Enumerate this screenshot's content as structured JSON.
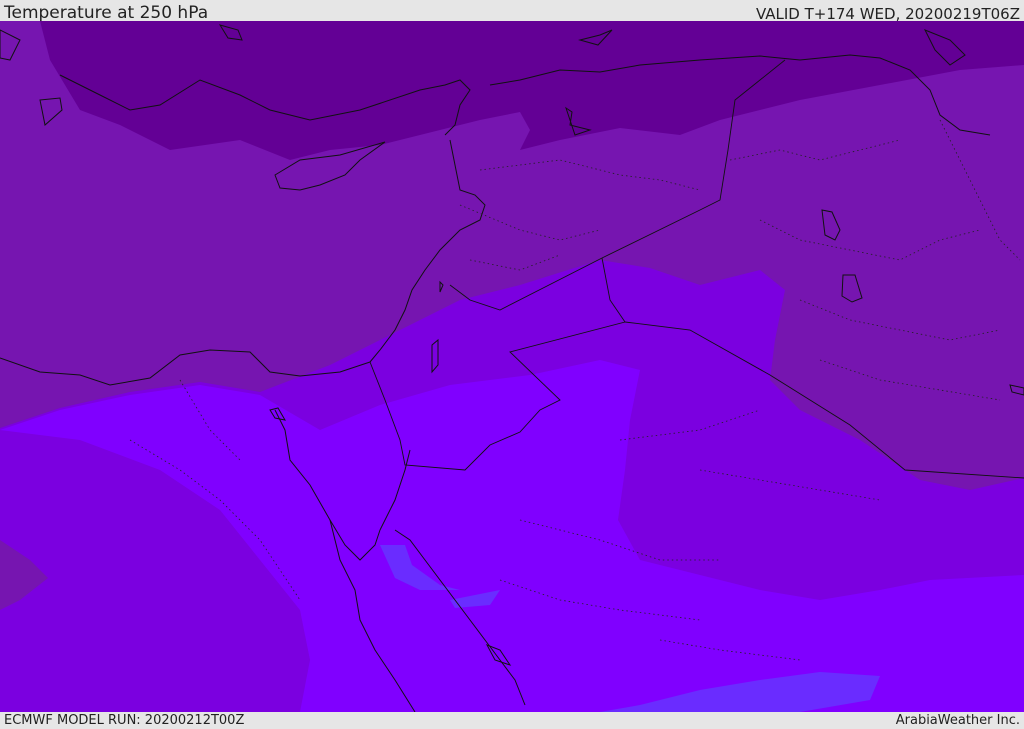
{
  "header": {
    "title": "Temperature at 250 hPa",
    "valid": "VALID T+174 WED, 20200219T06Z"
  },
  "footer": {
    "model_run": "ECMWF MODEL RUN: 20200212T00Z",
    "credit": "ArabiaWeather Inc."
  },
  "map": {
    "region": "Eastern Mediterranean and Middle East",
    "colors": {
      "coldest": "#630095",
      "cold": "#7615b0",
      "mid": "#7b00e0",
      "warm": "#8000ff",
      "warmest": "#6a2cff",
      "coast": "#111111",
      "border": "#111111"
    }
  }
}
